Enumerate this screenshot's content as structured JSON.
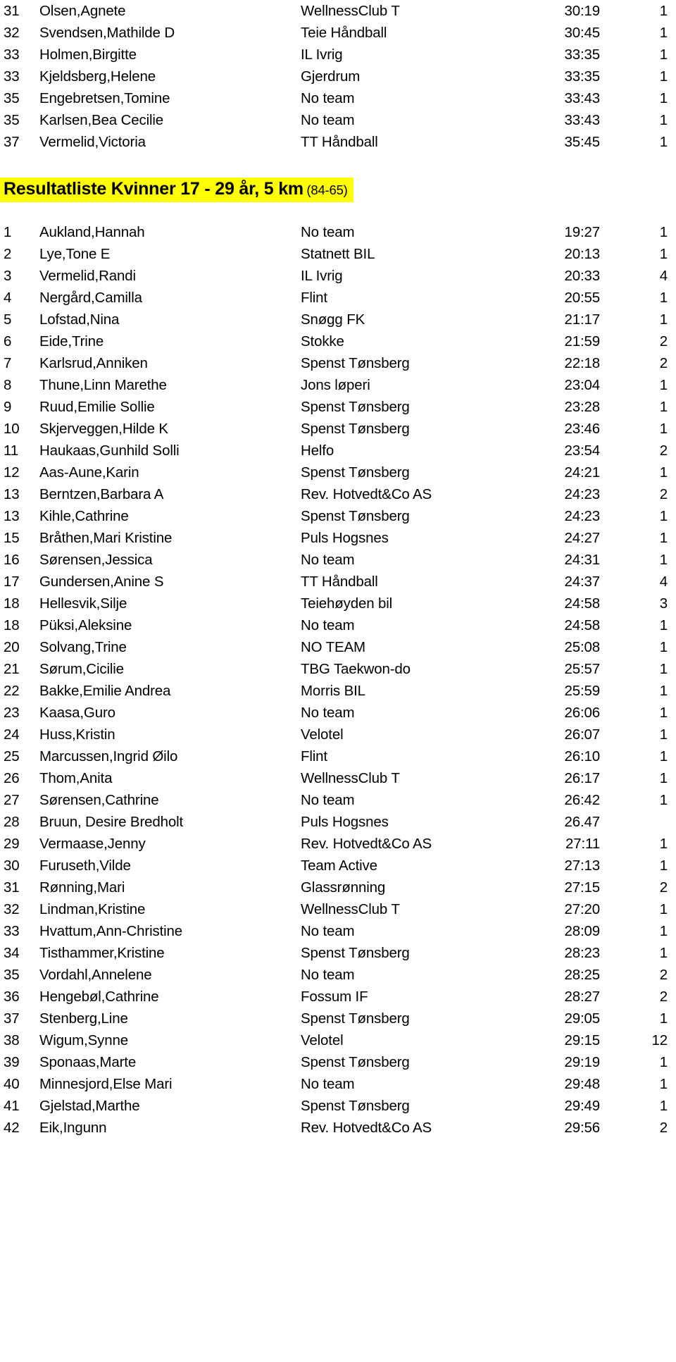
{
  "document": {
    "columns": [
      "rank",
      "name",
      "team",
      "time",
      "extra"
    ]
  },
  "top_rows": [
    {
      "rank": "31",
      "name": "Olsen,Agnete",
      "team": "WellnessClub T",
      "time": "30:19",
      "extra": "1"
    },
    {
      "rank": "32",
      "name": "Svendsen,Mathilde D",
      "team": "Teie Håndball",
      "time": "30:45",
      "extra": "1"
    },
    {
      "rank": "33",
      "name": "Holmen,Birgitte",
      "team": "IL Ivrig",
      "time": "33:35",
      "extra": "1"
    },
    {
      "rank": "33",
      "name": "Kjeldsberg,Helene",
      "team": "Gjerdrum",
      "time": "33:35",
      "extra": "1"
    },
    {
      "rank": "35",
      "name": "Engebretsen,Tomine",
      "team": "No team",
      "time": "33:43",
      "extra": "1"
    },
    {
      "rank": "35",
      "name": "Karlsen,Bea Cecilie",
      "team": "No team",
      "time": "33:43",
      "extra": "1"
    },
    {
      "rank": "37",
      "name": "Vermelid,Victoria",
      "team": "TT Håndball",
      "time": "35:45",
      "extra": "1"
    }
  ],
  "heading": {
    "title_main": "Resultatliste Kvinner 17 - 29 år, 5 km",
    "title_sub": "(84-65)",
    "highlight_color": "#ffff00"
  },
  "rows": [
    {
      "rank": "1",
      "name": "Aukland,Hannah",
      "team": "No team",
      "time": "19:27",
      "extra": "1"
    },
    {
      "rank": "2",
      "name": "Lye,Tone E",
      "team": "Statnett BIL",
      "time": "20:13",
      "extra": "1"
    },
    {
      "rank": "3",
      "name": "Vermelid,Randi",
      "team": "IL Ivrig",
      "time": "20:33",
      "extra": "4"
    },
    {
      "rank": "4",
      "name": "Nergård,Camilla",
      "team": "Flint",
      "time": "20:55",
      "extra": "1"
    },
    {
      "rank": "5",
      "name": "Lofstad,Nina",
      "team": "Snøgg FK",
      "time": "21:17",
      "extra": "1"
    },
    {
      "rank": "6",
      "name": "Eide,Trine",
      "team": "Stokke",
      "time": "21:59",
      "extra": "2"
    },
    {
      "rank": "7",
      "name": "Karlsrud,Anniken",
      "team": "Spenst Tønsberg",
      "time": "22:18",
      "extra": "2"
    },
    {
      "rank": "8",
      "name": "Thune,Linn Marethe",
      "team": "Jons løperi",
      "time": "23:04",
      "extra": "1"
    },
    {
      "rank": "9",
      "name": "Ruud,Emilie Sollie",
      "team": "Spenst Tønsberg",
      "time": "23:28",
      "extra": "1"
    },
    {
      "rank": "10",
      "name": "Skjerveggen,Hilde K",
      "team": "Spenst Tønsberg",
      "time": "23:46",
      "extra": "1"
    },
    {
      "rank": "11",
      "name": "Haukaas,Gunhild Solli",
      "team": "Helfo",
      "time": "23:54",
      "extra": "2"
    },
    {
      "rank": "12",
      "name": "Aas-Aune,Karin",
      "team": "Spenst Tønsberg",
      "time": "24:21",
      "extra": "1"
    },
    {
      "rank": "13",
      "name": "Berntzen,Barbara A",
      "team": "Rev. Hotvedt&Co AS",
      "time": "24:23",
      "extra": "2"
    },
    {
      "rank": "13",
      "name": "Kihle,Cathrine",
      "team": "Spenst Tønsberg",
      "time": "24:23",
      "extra": "1"
    },
    {
      "rank": "15",
      "name": "Bråthen,Mari Kristine",
      "team": "Puls Hogsnes",
      "time": "24:27",
      "extra": "1"
    },
    {
      "rank": "16",
      "name": "Sørensen,Jessica",
      "team": "No team",
      "time": "24:31",
      "extra": "1"
    },
    {
      "rank": "17",
      "name": "Gundersen,Anine S",
      "team": "TT Håndball",
      "time": "24:37",
      "extra": "4"
    },
    {
      "rank": "18",
      "name": "Hellesvik,Silje",
      "team": "Teiehøyden bil",
      "time": "24:58",
      "extra": "3"
    },
    {
      "rank": "18",
      "name": "Püksi,Aleksine",
      "team": "No team",
      "time": "24:58",
      "extra": "1"
    },
    {
      "rank": "20",
      "name": "Solvang,Trine",
      "team": "NO TEAM",
      "time": "25:08",
      "extra": "1"
    },
    {
      "rank": "21",
      "name": "Sørum,Cicilie",
      "team": "TBG Taekwon-do",
      "time": "25:57",
      "extra": "1"
    },
    {
      "rank": "22",
      "name": "Bakke,Emilie Andrea",
      "team": "Morris BIL",
      "time": "25:59",
      "extra": "1"
    },
    {
      "rank": "23",
      "name": "Kaasa,Guro",
      "team": "No team",
      "time": "26:06",
      "extra": "1"
    },
    {
      "rank": "24",
      "name": "Huss,Kristin",
      "team": "Velotel",
      "time": "26:07",
      "extra": "1"
    },
    {
      "rank": "25",
      "name": "Marcussen,Ingrid Øilo",
      "team": "Flint",
      "time": "26:10",
      "extra": "1"
    },
    {
      "rank": "26",
      "name": "Thom,Anita",
      "team": "WellnessClub T",
      "time": "26:17",
      "extra": "1"
    },
    {
      "rank": "27",
      "name": "Sørensen,Cathrine",
      "team": "No team",
      "time": "26:42",
      "extra": "1"
    },
    {
      "rank": "28",
      "name": "Bruun, Desire Bredholt",
      "team": "Puls Hogsnes",
      "time": "26.47",
      "extra": ""
    },
    {
      "rank": "29",
      "name": "Vermaase,Jenny",
      "team": "Rev. Hotvedt&Co AS",
      "time": "27:11",
      "extra": "1"
    },
    {
      "rank": "30",
      "name": "Furuseth,Vilde",
      "team": "Team Active",
      "time": "27:13",
      "extra": "1"
    },
    {
      "rank": "31",
      "name": "Rønning,Mari",
      "team": "Glassrønning",
      "time": "27:15",
      "extra": "2"
    },
    {
      "rank": "32",
      "name": "Lindman,Kristine",
      "team": "WellnessClub T",
      "time": "27:20",
      "extra": "1"
    },
    {
      "rank": "33",
      "name": "Hvattum,Ann-Christine",
      "team": "No team",
      "time": "28:09",
      "extra": "1"
    },
    {
      "rank": "34",
      "name": "Tisthammer,Kristine",
      "team": "Spenst Tønsberg",
      "time": "28:23",
      "extra": "1"
    },
    {
      "rank": "35",
      "name": "Vordahl,Annelene",
      "team": "No team",
      "time": "28:25",
      "extra": "2"
    },
    {
      "rank": "36",
      "name": "Hengebøl,Cathrine",
      "team": "Fossum IF",
      "time": "28:27",
      "extra": "2"
    },
    {
      "rank": "37",
      "name": "Stenberg,Line",
      "team": "Spenst Tønsberg",
      "time": "29:05",
      "extra": "1"
    },
    {
      "rank": "38",
      "name": "Wigum,Synne",
      "team": "Velotel",
      "time": "29:15",
      "extra": "12"
    },
    {
      "rank": "39",
      "name": "Sponaas,Marte",
      "team": "Spenst Tønsberg",
      "time": "29:19",
      "extra": "1"
    },
    {
      "rank": "40",
      "name": "Minnesjord,Else Mari",
      "team": "No team",
      "time": "29:48",
      "extra": "1"
    },
    {
      "rank": "41",
      "name": "Gjelstad,Marthe",
      "team": "Spenst Tønsberg",
      "time": "29:49",
      "extra": "1"
    },
    {
      "rank": "42",
      "name": "Eik,Ingunn",
      "team": "Rev. Hotvedt&Co AS",
      "time": "29:56",
      "extra": "2"
    }
  ]
}
